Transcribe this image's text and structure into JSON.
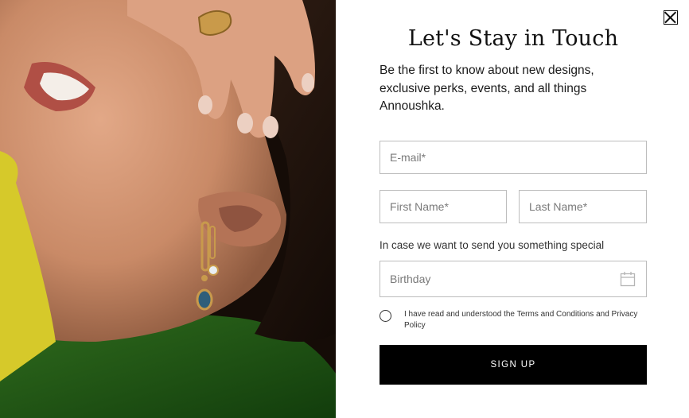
{
  "popup": {
    "title": "Let's Stay in Touch",
    "intro": "Be the first to know about new designs, exclusive perks, events, and all things Annoushka.",
    "email_placeholder": "E-mail*",
    "first_name_placeholder": "First Name*",
    "last_name_placeholder": "Last Name*",
    "special_label": "In case we want to send you something special",
    "birthday_placeholder": "Birthday",
    "terms_text": "I have read and understood the Terms and Conditions and Privacy Policy",
    "signup_label": "SIGN UP"
  },
  "icons": {
    "close": "close-icon",
    "calendar": "calendar-icon"
  },
  "colors": {
    "button_bg": "#000000",
    "button_text": "#ffffff",
    "field_border": "#bdbdbd"
  }
}
